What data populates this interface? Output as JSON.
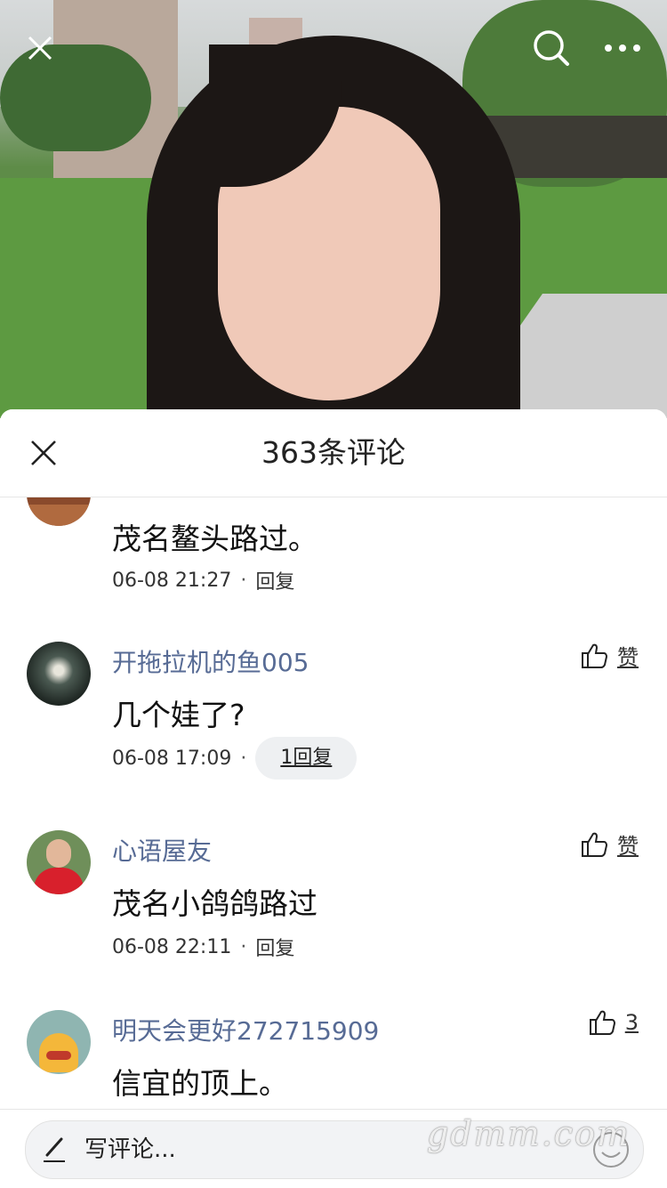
{
  "sheet": {
    "title": "363条评论"
  },
  "comments": [
    {
      "user": "",
      "text": "茂名鳌头路过。",
      "time": "06-08 21:27",
      "reply": "回复",
      "like": ""
    },
    {
      "user": "开拖拉机的鱼005",
      "text": "几个娃了?",
      "time": "06-08 17:09",
      "reply": "1回复",
      "like": "赞"
    },
    {
      "user": "心语屋友",
      "text": "茂名小鸽鸽路过",
      "time": "06-08 22:11",
      "reply": "回复",
      "like": "赞"
    },
    {
      "user": "明天会更好272715909",
      "text": "信宜的顶上。",
      "time": "",
      "reply": "",
      "like": "3"
    }
  ],
  "input": {
    "placeholder": "写评论..."
  },
  "watermark": "gdmm.com",
  "icons": {
    "close": "close-icon",
    "search": "search-icon",
    "more": "more-icon",
    "like": "thumb-up-icon",
    "pen": "pen-icon",
    "emoji": "emoji-icon"
  },
  "colors": {
    "username": "#576b95",
    "accent": "#576b95"
  }
}
